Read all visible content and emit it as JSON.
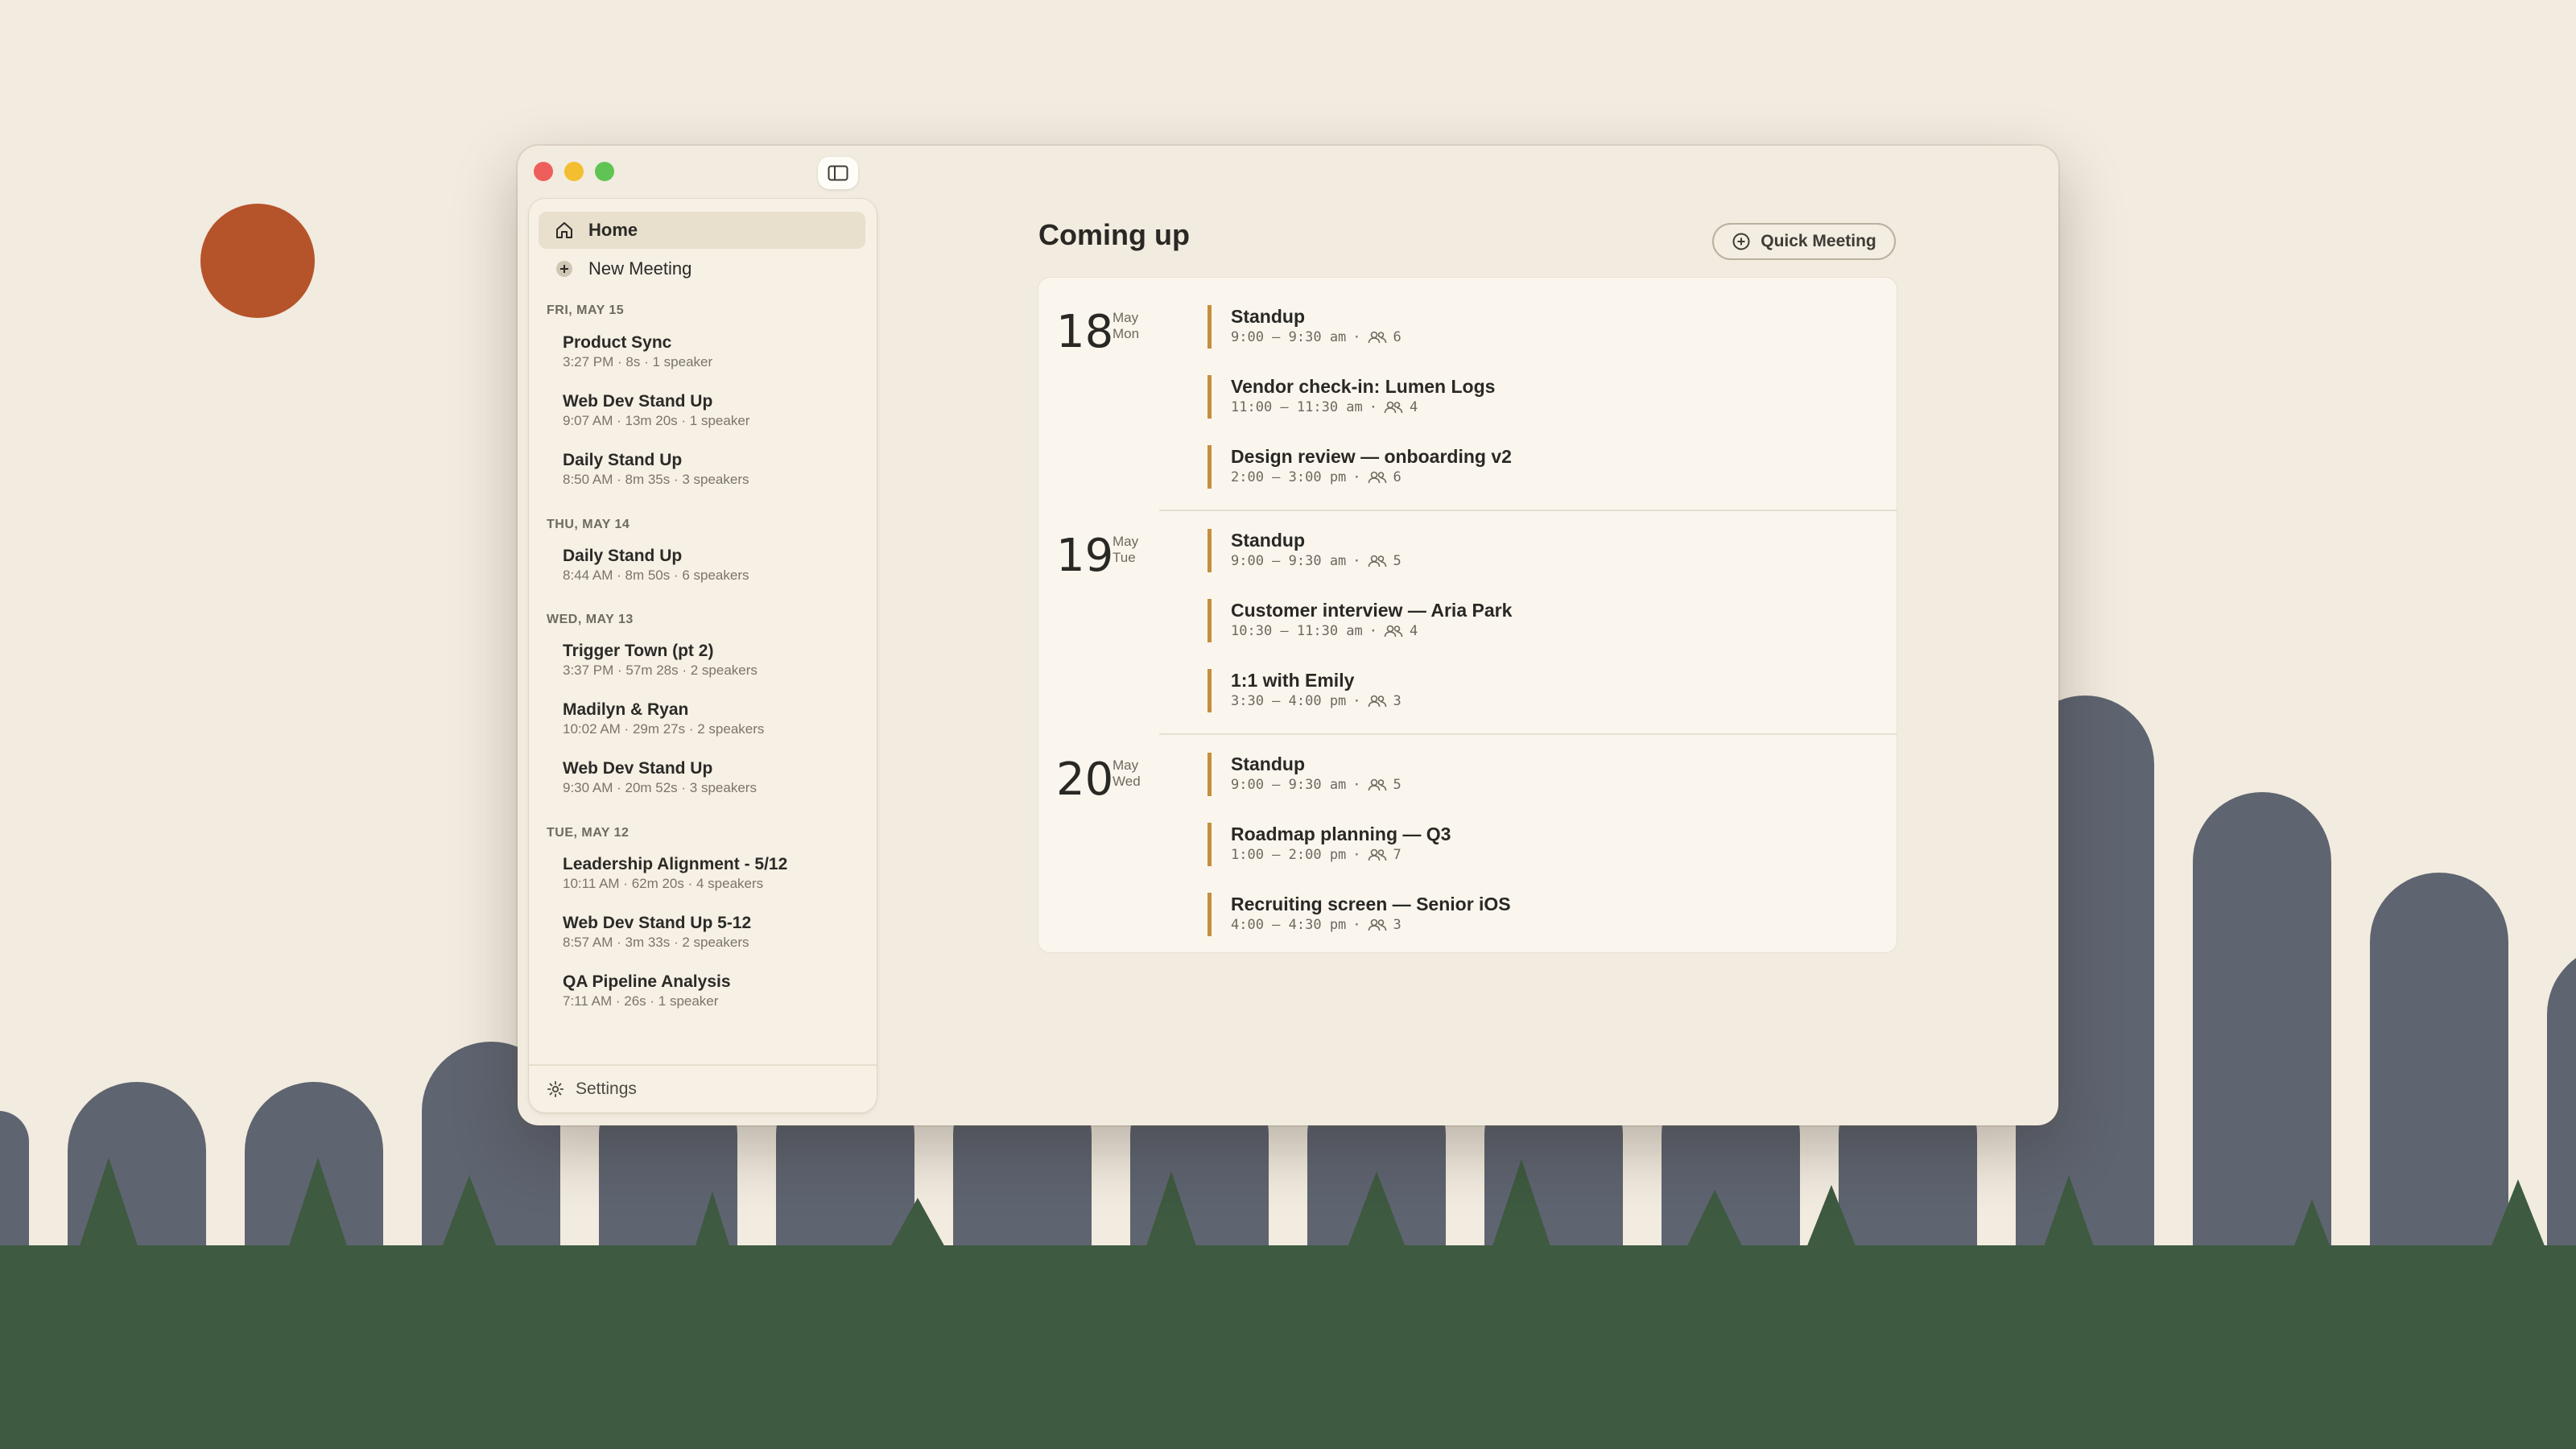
{
  "sidebar": {
    "nav": [
      {
        "label": "Home"
      },
      {
        "label": "New Meeting"
      }
    ],
    "sections": [
      {
        "heading": "FRI, MAY 15",
        "items": [
          {
            "title": "Product Sync",
            "time": "3:27 PM",
            "duration": "8s",
            "speakers": "1 speaker"
          },
          {
            "title": "Web Dev Stand Up",
            "time": "9:07 AM",
            "duration": "13m 20s",
            "speakers": "1 speaker"
          },
          {
            "title": "Daily Stand Up",
            "time": "8:50 AM",
            "duration": "8m 35s",
            "speakers": "3 speakers"
          }
        ]
      },
      {
        "heading": "THU, MAY 14",
        "items": [
          {
            "title": "Daily Stand Up",
            "time": "8:44 AM",
            "duration": "8m 50s",
            "speakers": "6 speakers"
          }
        ]
      },
      {
        "heading": "WED, MAY 13",
        "items": [
          {
            "title": "Trigger Town (pt 2)",
            "time": "3:37 PM",
            "duration": "57m 28s",
            "speakers": "2 speakers"
          },
          {
            "title": "Madilyn & Ryan",
            "time": "10:02 AM",
            "duration": "29m 27s",
            "speakers": "2 speakers"
          },
          {
            "title": "Web Dev Stand Up",
            "time": "9:30 AM",
            "duration": "20m 52s",
            "speakers": "3 speakers"
          }
        ]
      },
      {
        "heading": "TUE, MAY 12",
        "items": [
          {
            "title": "Leadership Alignment - 5/12",
            "time": "10:11 AM",
            "duration": "62m 20s",
            "speakers": "4 speakers"
          },
          {
            "title": "Web Dev Stand Up 5-12",
            "time": "8:57 AM",
            "duration": "3m 33s",
            "speakers": "2 speakers"
          },
          {
            "title": "QA Pipeline Analysis",
            "time": "7:11 AM",
            "duration": "26s",
            "speakers": "1 speaker"
          }
        ]
      }
    ],
    "settings_label": "Settings"
  },
  "main": {
    "title": "Coming up",
    "quick_meeting_label": "Quick Meeting",
    "days": [
      {
        "num": "18",
        "month": "May",
        "weekday": "Mon",
        "events": [
          {
            "title": "Standup",
            "time": "9:00 – 9:30 am",
            "count": "6"
          },
          {
            "title": "Vendor check-in: Lumen Logs",
            "time": "11:00 – 11:30 am",
            "count": "4"
          },
          {
            "title": "Design review — onboarding v2",
            "time": "2:00 – 3:00 pm",
            "count": "6"
          }
        ]
      },
      {
        "num": "19",
        "month": "May",
        "weekday": "Tue",
        "events": [
          {
            "title": "Standup",
            "time": "9:00 – 9:30 am",
            "count": "5"
          },
          {
            "title": "Customer interview — Aria Park",
            "time": "10:30 – 11:30 am",
            "count": "4"
          },
          {
            "title": "1:1 with Emily",
            "time": "3:30 – 4:00 pm",
            "count": "3"
          }
        ]
      },
      {
        "num": "20",
        "month": "May",
        "weekday": "Wed",
        "events": [
          {
            "title": "Standup",
            "time": "9:00 – 9:30 am",
            "count": "5"
          },
          {
            "title": "Roadmap planning — Q3",
            "time": "1:00 – 2:00 pm",
            "count": "7"
          },
          {
            "title": "Recruiting screen — Senior iOS",
            "time": "4:00 – 4:30 pm",
            "count": "3"
          }
        ]
      }
    ]
  },
  "colors": {
    "background": "#f2ebdf",
    "sun": "#b5532b",
    "hills": "#5e6470",
    "ground": "#3e5a41",
    "event_accent": "#c48f3d"
  }
}
